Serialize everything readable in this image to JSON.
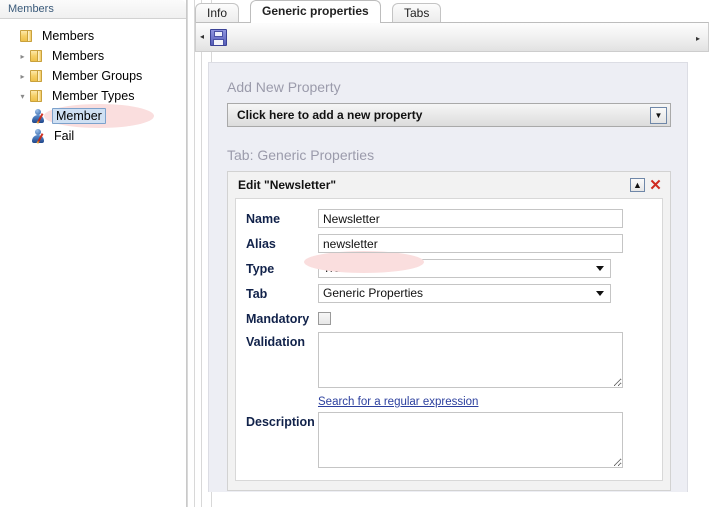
{
  "tree": {
    "header": "Members",
    "nodes": [
      {
        "label": "Members",
        "icon": "folder-icon",
        "indent": 0,
        "toggle": "none",
        "selected": false
      },
      {
        "label": "Members",
        "icon": "folder-icon",
        "indent": 1,
        "toggle": "collapsed",
        "selected": false
      },
      {
        "label": "Member Groups",
        "icon": "folder-icon",
        "indent": 1,
        "toggle": "collapsed",
        "selected": false
      },
      {
        "label": "Member Types",
        "icon": "folder-icon",
        "indent": 1,
        "toggle": "expanded",
        "selected": false
      },
      {
        "label": "Member",
        "icon": "member-icon",
        "indent": 2,
        "toggle": "none",
        "selected": true
      },
      {
        "label": "Fail",
        "icon": "member-icon",
        "indent": 2,
        "toggle": "none",
        "selected": false
      }
    ]
  },
  "tabs": [
    {
      "label": "Info",
      "active": false
    },
    {
      "label": "Generic properties",
      "active": true
    },
    {
      "label": "Tabs",
      "active": false
    }
  ],
  "toolbar": {
    "left_arrow": "◂",
    "right_arrow": "▸",
    "save_icon": "save-icon"
  },
  "content": {
    "add_new_property_heading": "Add New Property",
    "add_new_property_value": "Click here to add a new property",
    "tab_heading": "Tab: Generic Properties"
  },
  "edit_panel": {
    "title": "Edit \"Newsletter\"",
    "collapse_glyph": "▲",
    "close_glyph": "✕",
    "fields": {
      "name_label": "Name",
      "name_value": "Newsletter",
      "alias_label": "Alias",
      "alias_value": "newsletter",
      "type_label": "Type",
      "type_value": "True/false",
      "tab_label": "Tab",
      "tab_value": "Generic Properties",
      "mandatory_label": "Mandatory",
      "mandatory_checked": false,
      "validation_label": "Validation",
      "validation_value": "",
      "regex_link": "Search for a regular expression",
      "description_label": "Description",
      "description_value": ""
    }
  },
  "colors": {
    "card_bg": "#edeef4",
    "heading_gray": "#9b9bab",
    "label_navy": "#11224a",
    "link_blue": "#2b3f9e",
    "highlight_pink": "#fadede",
    "close_red": "#cf2a20",
    "selection_blue": "#cfe0f3"
  }
}
